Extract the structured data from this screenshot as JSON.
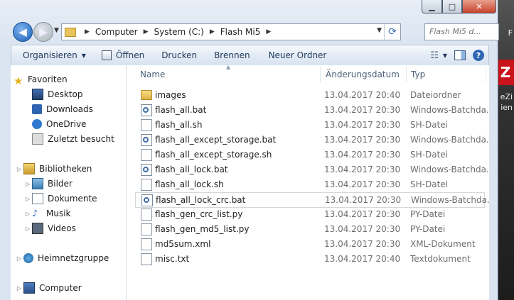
{
  "desktop": {
    "side_texts": [
      "F",
      "",
      "eZi",
      "ien"
    ],
    "badge": "Z"
  },
  "window": {
    "caption": {
      "minimize": "▁",
      "maximize": "□",
      "close": "✕"
    }
  },
  "nav": {
    "back_icon": "back-arrow-icon",
    "forward_icon": "forward-arrow-icon",
    "breadcrumb": [
      "Computer",
      "System (C:)",
      "Flash Mi5"
    ],
    "search_placeholder": "Flash Mi5 d..."
  },
  "toolbar": {
    "organize": "Organisieren",
    "open": "Öffnen",
    "print": "Drucken",
    "burn": "Brennen",
    "new_folder": "Neuer Ordner"
  },
  "navpane": {
    "favorites": "Favoriten",
    "fav_items": [
      "Desktop",
      "Downloads",
      "OneDrive",
      "Zuletzt besucht"
    ],
    "libraries": "Bibliotheken",
    "lib_items": [
      "Bilder",
      "Dokumente",
      "Musik",
      "Videos"
    ],
    "homegroup": "Heimnetzgruppe",
    "computer": "Computer"
  },
  "columns": {
    "name": "Name",
    "date": "Änderungsdatum",
    "type": "Typ"
  },
  "files": [
    {
      "name": "images",
      "date": "13.04.2017 20:40",
      "type": "Dateiordner",
      "icon": "folder-icon"
    },
    {
      "name": "flash_all.bat",
      "date": "13.04.2017 20:30",
      "type": "Windows-Batchda...",
      "icon": "batch-file-icon"
    },
    {
      "name": "flash_all.sh",
      "date": "13.04.2017 20:30",
      "type": "SH-Datei",
      "icon": "file-icon"
    },
    {
      "name": "flash_all_except_storage.bat",
      "date": "13.04.2017 20:30",
      "type": "Windows-Batchda...",
      "icon": "batch-file-icon"
    },
    {
      "name": "flash_all_except_storage.sh",
      "date": "13.04.2017 20:30",
      "type": "SH-Datei",
      "icon": "file-icon"
    },
    {
      "name": "flash_all_lock.bat",
      "date": "13.04.2017 20:30",
      "type": "Windows-Batchda...",
      "icon": "batch-file-icon"
    },
    {
      "name": "flash_all_lock.sh",
      "date": "13.04.2017 20:30",
      "type": "SH-Datei",
      "icon": "file-icon"
    },
    {
      "name": "flash_all_lock_crc.bat",
      "date": "13.04.2017 20:30",
      "type": "Windows-Batchda...",
      "icon": "batch-file-icon"
    },
    {
      "name": "flash_gen_crc_list.py",
      "date": "13.04.2017 20:30",
      "type": "PY-Datei",
      "icon": "file-icon"
    },
    {
      "name": "flash_gen_md5_list.py",
      "date": "13.04.2017 20:30",
      "type": "PY-Datei",
      "icon": "file-icon"
    },
    {
      "name": "md5sum.xml",
      "date": "13.04.2017 20:30",
      "type": "XML-Dokument",
      "icon": "file-icon"
    },
    {
      "name": "misc.txt",
      "date": "13.04.2017 20:40",
      "type": "Textdokument",
      "icon": "file-icon"
    }
  ]
}
